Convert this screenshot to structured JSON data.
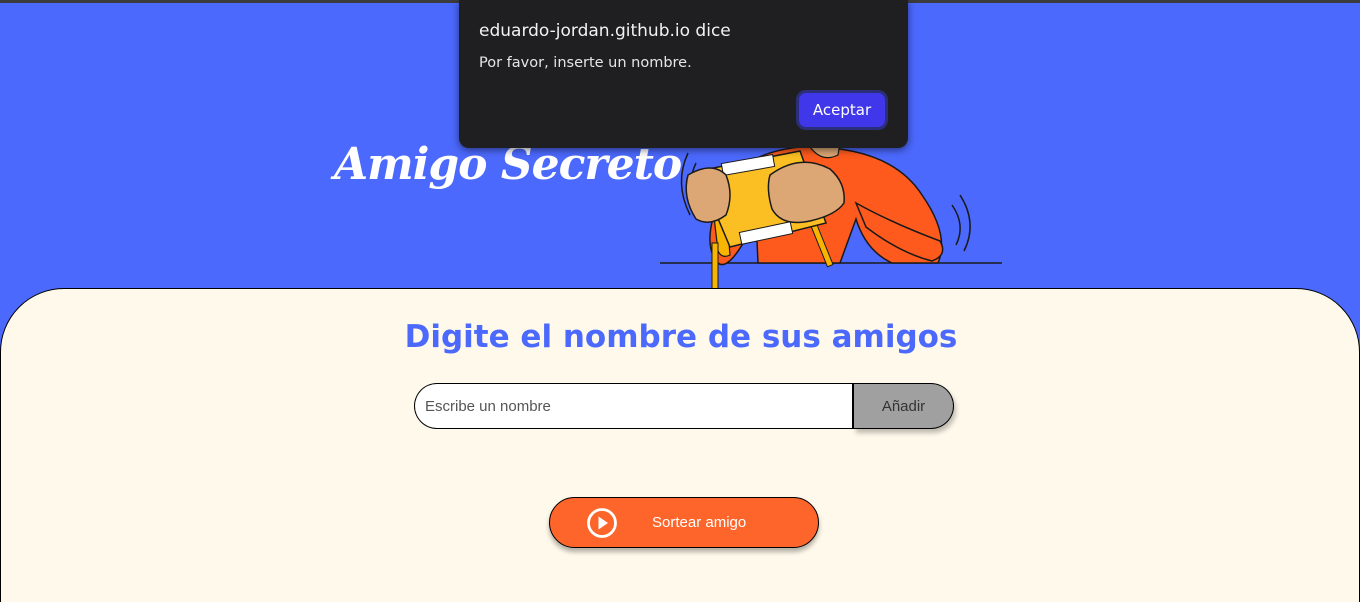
{
  "header": {
    "title": "Amigo Secreto"
  },
  "main": {
    "subtitle": "Digite el nombre de sus amigos",
    "name_input": {
      "placeholder": "Escribe un nombre",
      "value": ""
    },
    "add_button_label": "Añadir",
    "draw_button_label": "Sortear amigo",
    "draw_button_icon": "play-circle-icon"
  },
  "alert_dialog": {
    "origin": "eduardo-jordan.github.io dice",
    "message": "Por favor, inserte un nombre.",
    "ok_label": "Aceptar"
  },
  "colors": {
    "header_background": "#4b69fd",
    "main_background": "#fff9eb",
    "accent_orange": "#fe652b",
    "dialog_background": "#1f1f22",
    "dialog_button": "#4137ea"
  }
}
